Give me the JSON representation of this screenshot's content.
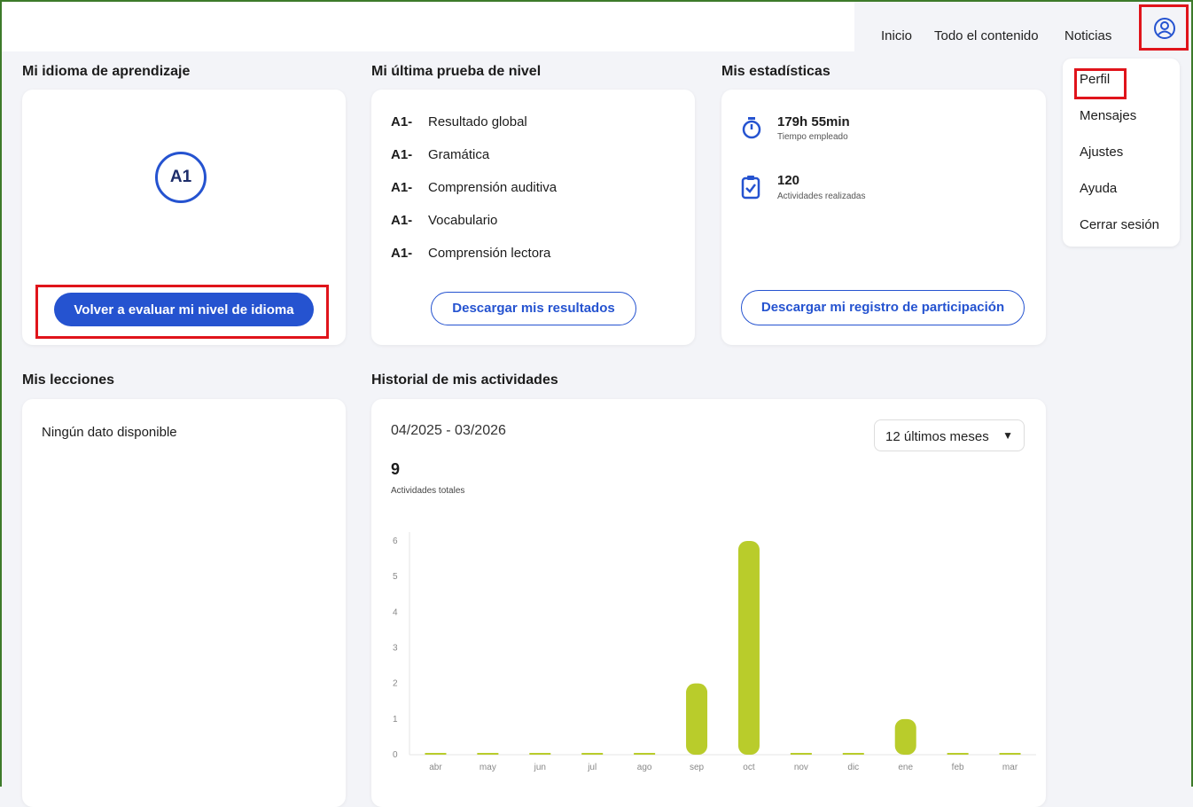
{
  "nav": {
    "links": [
      "Inicio",
      "Todo el contenido",
      "Noticias"
    ],
    "user_icon": "user-circle-icon"
  },
  "user_menu": {
    "items": [
      "Perfil",
      "Mensajes",
      "Ajustes",
      "Ayuda",
      "Cerrar sesión"
    ]
  },
  "language": {
    "title": "Mi idioma de aprendizaje",
    "level": "A1",
    "button": "Volver a evaluar mi nivel de idioma"
  },
  "test": {
    "title": "Mi última prueba de nivel",
    "results": [
      {
        "level": "A1-",
        "label": "Resultado global"
      },
      {
        "level": "A1-",
        "label": "Gramática"
      },
      {
        "level": "A1-",
        "label": "Comprensión auditiva"
      },
      {
        "level": "A1-",
        "label": "Vocabulario"
      },
      {
        "level": "A1-",
        "label": "Comprensión lectora"
      }
    ],
    "button": "Descargar mis resultados"
  },
  "stats": {
    "title": "Mis estadísticas",
    "time_value": "179h 55min",
    "time_label": "Tiempo empleado",
    "activities_value": "120",
    "activities_label": "Actividades realizadas",
    "button": "Descargar mi registro de participación",
    "icons": [
      "stopwatch-icon",
      "clipboard-check-icon"
    ]
  },
  "lessons": {
    "title": "Mis lecciones",
    "empty": "Ningún dato disponible"
  },
  "history": {
    "title": "Historial de mis actividades",
    "range": "04/2025 - 03/2026",
    "period_select": "12 últimos meses",
    "total_value": "9",
    "total_label": "Actividades totales"
  },
  "colors": {
    "accent": "#2553d0",
    "bar": "#b9cc2b",
    "highlight": "#e0141b"
  },
  "chart_data": {
    "type": "bar",
    "categories": [
      "abr",
      "may",
      "jun",
      "jul",
      "ago",
      "sep",
      "oct",
      "nov",
      "dic",
      "ene",
      "feb",
      "mar"
    ],
    "values": [
      0,
      0,
      0,
      0,
      0,
      2,
      6,
      0,
      0,
      1,
      0,
      0
    ],
    "ylim": [
      0,
      6
    ],
    "yticks": [
      0,
      1,
      2,
      3,
      4,
      5,
      6
    ],
    "grid": false
  }
}
